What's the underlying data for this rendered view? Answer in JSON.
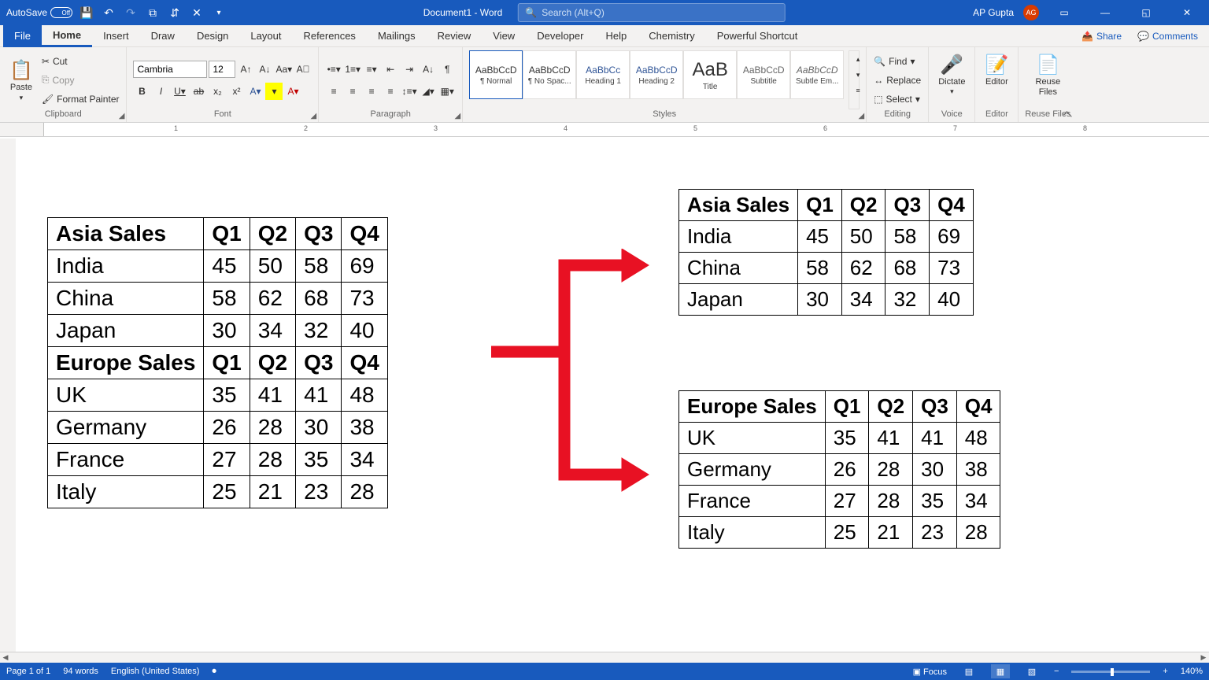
{
  "titlebar": {
    "autosave_label": "AutoSave",
    "autosave_state": "Off",
    "doc_title": "Document1 - Word",
    "search_placeholder": "Search (Alt+Q)",
    "user_name": "AP Gupta",
    "user_initials": "AG"
  },
  "tabs": {
    "file": "File",
    "home": "Home",
    "insert": "Insert",
    "draw": "Draw",
    "design": "Design",
    "layout": "Layout",
    "references": "References",
    "mailings": "Mailings",
    "review": "Review",
    "view": "View",
    "developer": "Developer",
    "help": "Help",
    "chemistry": "Chemistry",
    "shortcut": "Powerful Shortcut",
    "share": "Share",
    "comments": "Comments"
  },
  "ribbon": {
    "clipboard": {
      "label": "Clipboard",
      "paste": "Paste",
      "cut": "Cut",
      "copy": "Copy",
      "format_painter": "Format Painter"
    },
    "font": {
      "label": "Font",
      "name": "Cambria",
      "size": "12"
    },
    "paragraph": {
      "label": "Paragraph"
    },
    "styles": {
      "label": "Styles",
      "items": [
        {
          "preview": "AaBbCcD",
          "name": "¶ Normal"
        },
        {
          "preview": "AaBbCcD",
          "name": "¶ No Spac..."
        },
        {
          "preview": "AaBbCc",
          "name": "Heading 1"
        },
        {
          "preview": "AaBbCcD",
          "name": "Heading 2"
        },
        {
          "preview": "AaB",
          "name": "Title"
        },
        {
          "preview": "AaBbCcD",
          "name": "Subtitle"
        },
        {
          "preview": "AaBbCcD",
          "name": "Subtle Em..."
        }
      ]
    },
    "editing": {
      "label": "Editing",
      "find": "Find",
      "replace": "Replace",
      "select": "Select"
    },
    "dictate": {
      "label": "Voice",
      "btn": "Dictate"
    },
    "editor": {
      "label": "Editor",
      "btn": "Editor"
    },
    "reuse": {
      "label": "Reuse Files",
      "btn": "Reuse\nFiles"
    }
  },
  "ruler_numbers": [
    "1",
    "2",
    "3",
    "4",
    "5",
    "6",
    "7",
    "8"
  ],
  "tables": {
    "combined": {
      "headers_asia": [
        "Asia Sales",
        "Q1",
        "Q2",
        "Q3",
        "Q4"
      ],
      "asia_rows": [
        [
          "India",
          "45",
          "50",
          "58",
          "69"
        ],
        [
          "China",
          "58",
          "62",
          "68",
          "73"
        ],
        [
          "Japan",
          "30",
          "34",
          "32",
          "40"
        ]
      ],
      "headers_europe": [
        "Europe Sales",
        "Q1",
        "Q2",
        "Q3",
        "Q4"
      ],
      "europe_rows": [
        [
          "UK",
          "35",
          "41",
          "41",
          "48"
        ],
        [
          "Germany",
          "26",
          "28",
          "30",
          "38"
        ],
        [
          "France",
          "27",
          "28",
          "35",
          "34"
        ],
        [
          "Italy",
          "25",
          "21",
          "23",
          "28"
        ]
      ]
    }
  },
  "statusbar": {
    "page": "Page 1 of 1",
    "words": "94 words",
    "language": "English (United States)",
    "focus": "Focus",
    "zoom": "140%"
  }
}
